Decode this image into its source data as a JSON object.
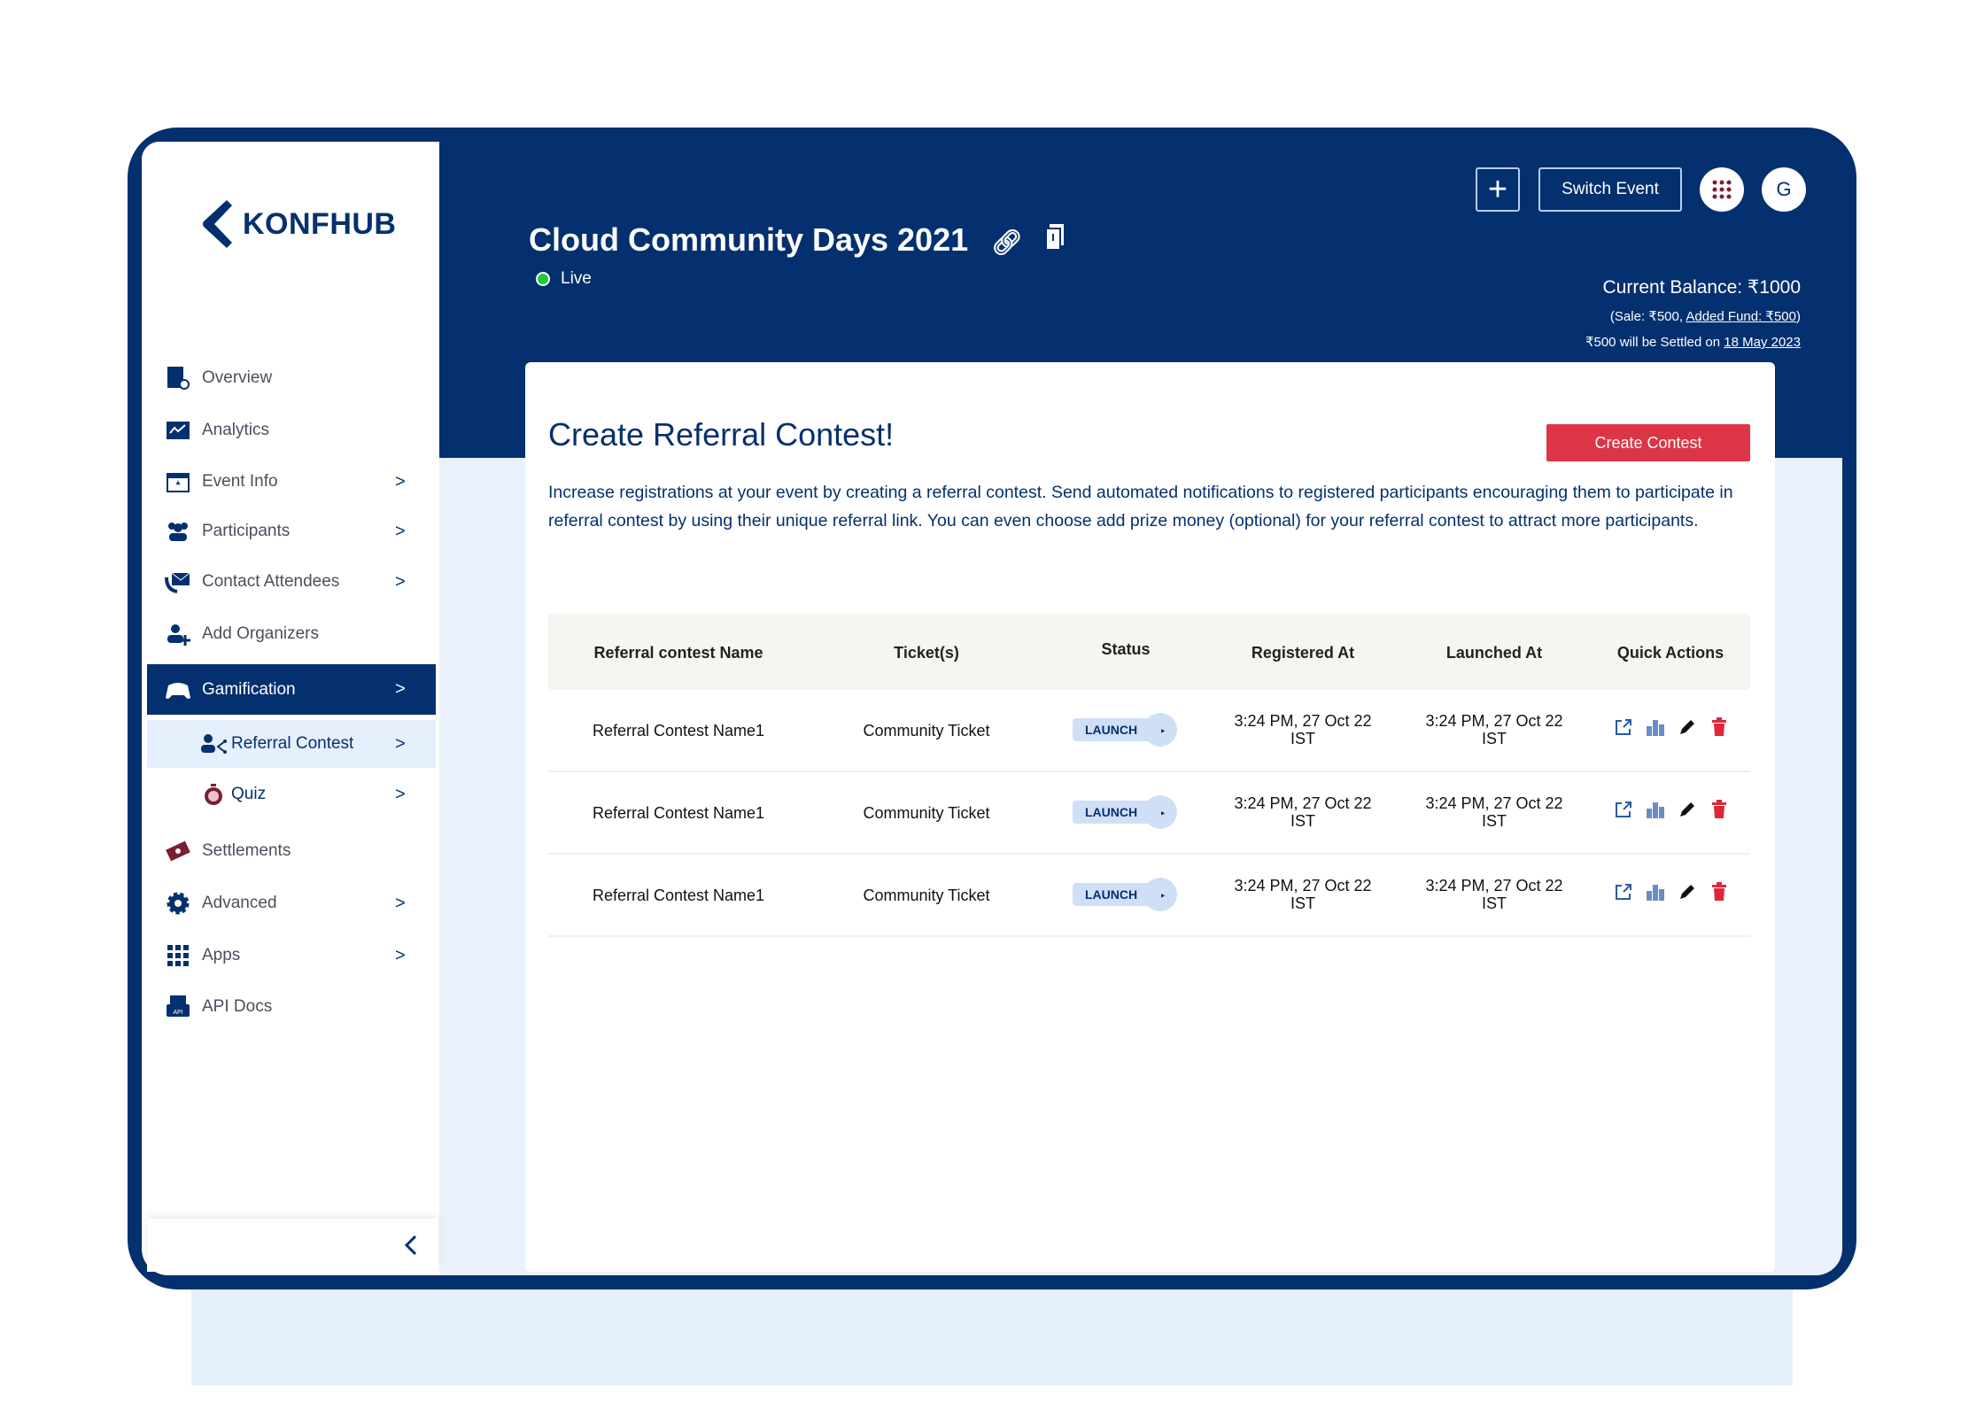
{
  "brand": {
    "logo_text": "KONFHUB",
    "navy": "#04306f",
    "accent_red": "#dc3545",
    "live_green": "#22c93a"
  },
  "sidebar": {
    "items": [
      {
        "label": "Overview",
        "icon": "document-search-icon"
      },
      {
        "label": "Analytics",
        "icon": "analytics-icon"
      },
      {
        "label": "Event Info",
        "icon": "calendar-star-icon",
        "chevron": true
      },
      {
        "label": "Participants",
        "icon": "users-icon",
        "chevron": true
      },
      {
        "label": "Contact Attendees",
        "icon": "mail-phone-icon",
        "chevron": true
      },
      {
        "label": "Add Organizers",
        "icon": "user-plus-icon"
      },
      {
        "label": "Gamification",
        "icon": "gamepad-icon",
        "chevron": true,
        "active": true
      },
      {
        "label": "Referral Contest",
        "icon": "user-share-icon",
        "chevron": true,
        "sub": true,
        "active": true
      },
      {
        "label": "Quiz",
        "icon": "stopwatch-icon",
        "chevron": true,
        "sub": true
      },
      {
        "label": "Settlements",
        "icon": "money-icon"
      },
      {
        "label": "Advanced",
        "icon": "gear-icon",
        "chevron": true
      },
      {
        "label": "Apps",
        "icon": "grid-icon",
        "chevron": true
      },
      {
        "label": "API Docs",
        "icon": "api-printer-icon"
      }
    ]
  },
  "header": {
    "event_title": "Cloud Community Days 2021",
    "status": "Live",
    "switch_event": "Switch Event",
    "add_label": "+",
    "avatar": "G",
    "balance": {
      "current": "Current Balance: ₹1000",
      "sale": "(Sale: ₹500, ",
      "added_fund": "Added Fund: ₹500",
      "close": ")",
      "settle_prefix": "₹500 will be Settled on ",
      "settle_date": "18 May 2023"
    }
  },
  "main": {
    "title": "Create Referral Contest!",
    "create_button": "Create Contest",
    "description": "Increase registrations at your event by creating a referral contest. Send automated notifications to registered participants encouraging them to participate in referral contest by using their unique referral link. You can even choose add prize money (optional) for your referral contest to attract more participants.",
    "table": {
      "columns": [
        "Referral contest Name",
        "Ticket(s)",
        "Status",
        "Registered At",
        "Launched At",
        "Quick Actions"
      ],
      "rows": [
        {
          "name": "Referral Contest Name1",
          "ticket": "Community Ticket",
          "status": "LAUNCH",
          "registered": "3:24 PM, 27 Oct 22",
          "registered_tz": "IST",
          "launched": "3:24 PM, 27 Oct 22",
          "launched_tz": "IST"
        },
        {
          "name": "Referral Contest Name1",
          "ticket": "Community Ticket",
          "status": "LAUNCH",
          "registered": "3:24 PM, 27 Oct 22",
          "registered_tz": "IST",
          "launched": "3:24 PM, 27 Oct 22",
          "launched_tz": "IST"
        },
        {
          "name": "Referral Contest Name1",
          "ticket": "Community Ticket",
          "status": "LAUNCH",
          "registered": "3:24 PM, 27 Oct 22",
          "registered_tz": "IST",
          "launched": "3:24 PM, 27 Oct 22",
          "launched_tz": "IST"
        }
      ]
    }
  }
}
